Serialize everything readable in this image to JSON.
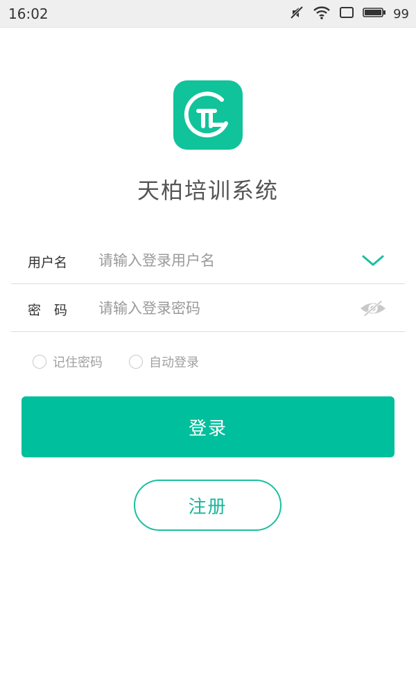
{
  "status_bar": {
    "time": "16:02",
    "battery_level": "99",
    "icons": [
      "mute-icon",
      "wifi-icon",
      "screen-rotation-icon",
      "battery-icon"
    ]
  },
  "app": {
    "logo_icon": "app-logo-icon",
    "title": "天柏培训系统",
    "accent_color": "#00bf9c"
  },
  "form": {
    "username": {
      "label": "用户名",
      "placeholder": "请输入登录用户名",
      "value": "",
      "trailing_icon": "chevron-down-icon"
    },
    "password": {
      "label": "密　码",
      "placeholder": "请输入登录密码",
      "value": "",
      "trailing_icon": "eye-hidden-icon"
    }
  },
  "options": {
    "remember_password": {
      "label": "记住密码",
      "checked": false
    },
    "auto_login": {
      "label": "自动登录",
      "checked": false
    }
  },
  "buttons": {
    "login": "登录",
    "register": "注册"
  }
}
